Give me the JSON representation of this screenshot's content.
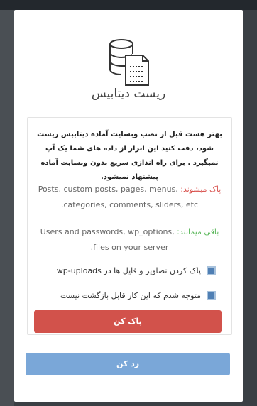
{
  "modal": {
    "title": "ریست دیتابیس",
    "warning": "بهتر هست قبل از نصب وبسایت آماده دیتابیس ریست شود، دقت کنید این ابزار از داده های شما یک آپ نمیگیرد . برای راه اندازی سریع بدون وبسایت آماده پیشنهاد نمیشود.",
    "deleted": {
      "label": "پاک میشوند:",
      "text": "Posts, custom posts, pages, menus, categories, comments, sliders, etc."
    },
    "kept": {
      "label": "باقی میمانند:",
      "text": "Users and passwords, wp_options, files on your server."
    },
    "checkbox_uploads": "پاک کردن تصاویر و فایل ها در wp-uploads",
    "checkbox_confirm": "متوجه شدم که این کار قابل بازگشت نیست",
    "delete_button": "پاک کن",
    "cancel_button": "رد کن"
  },
  "colors": {
    "danger": "#d2524b",
    "primary": "#7aa7d8",
    "success": "#5cb85c",
    "checkbox": "#4f7fb4"
  },
  "icons": {
    "header": "database-document-icon"
  }
}
